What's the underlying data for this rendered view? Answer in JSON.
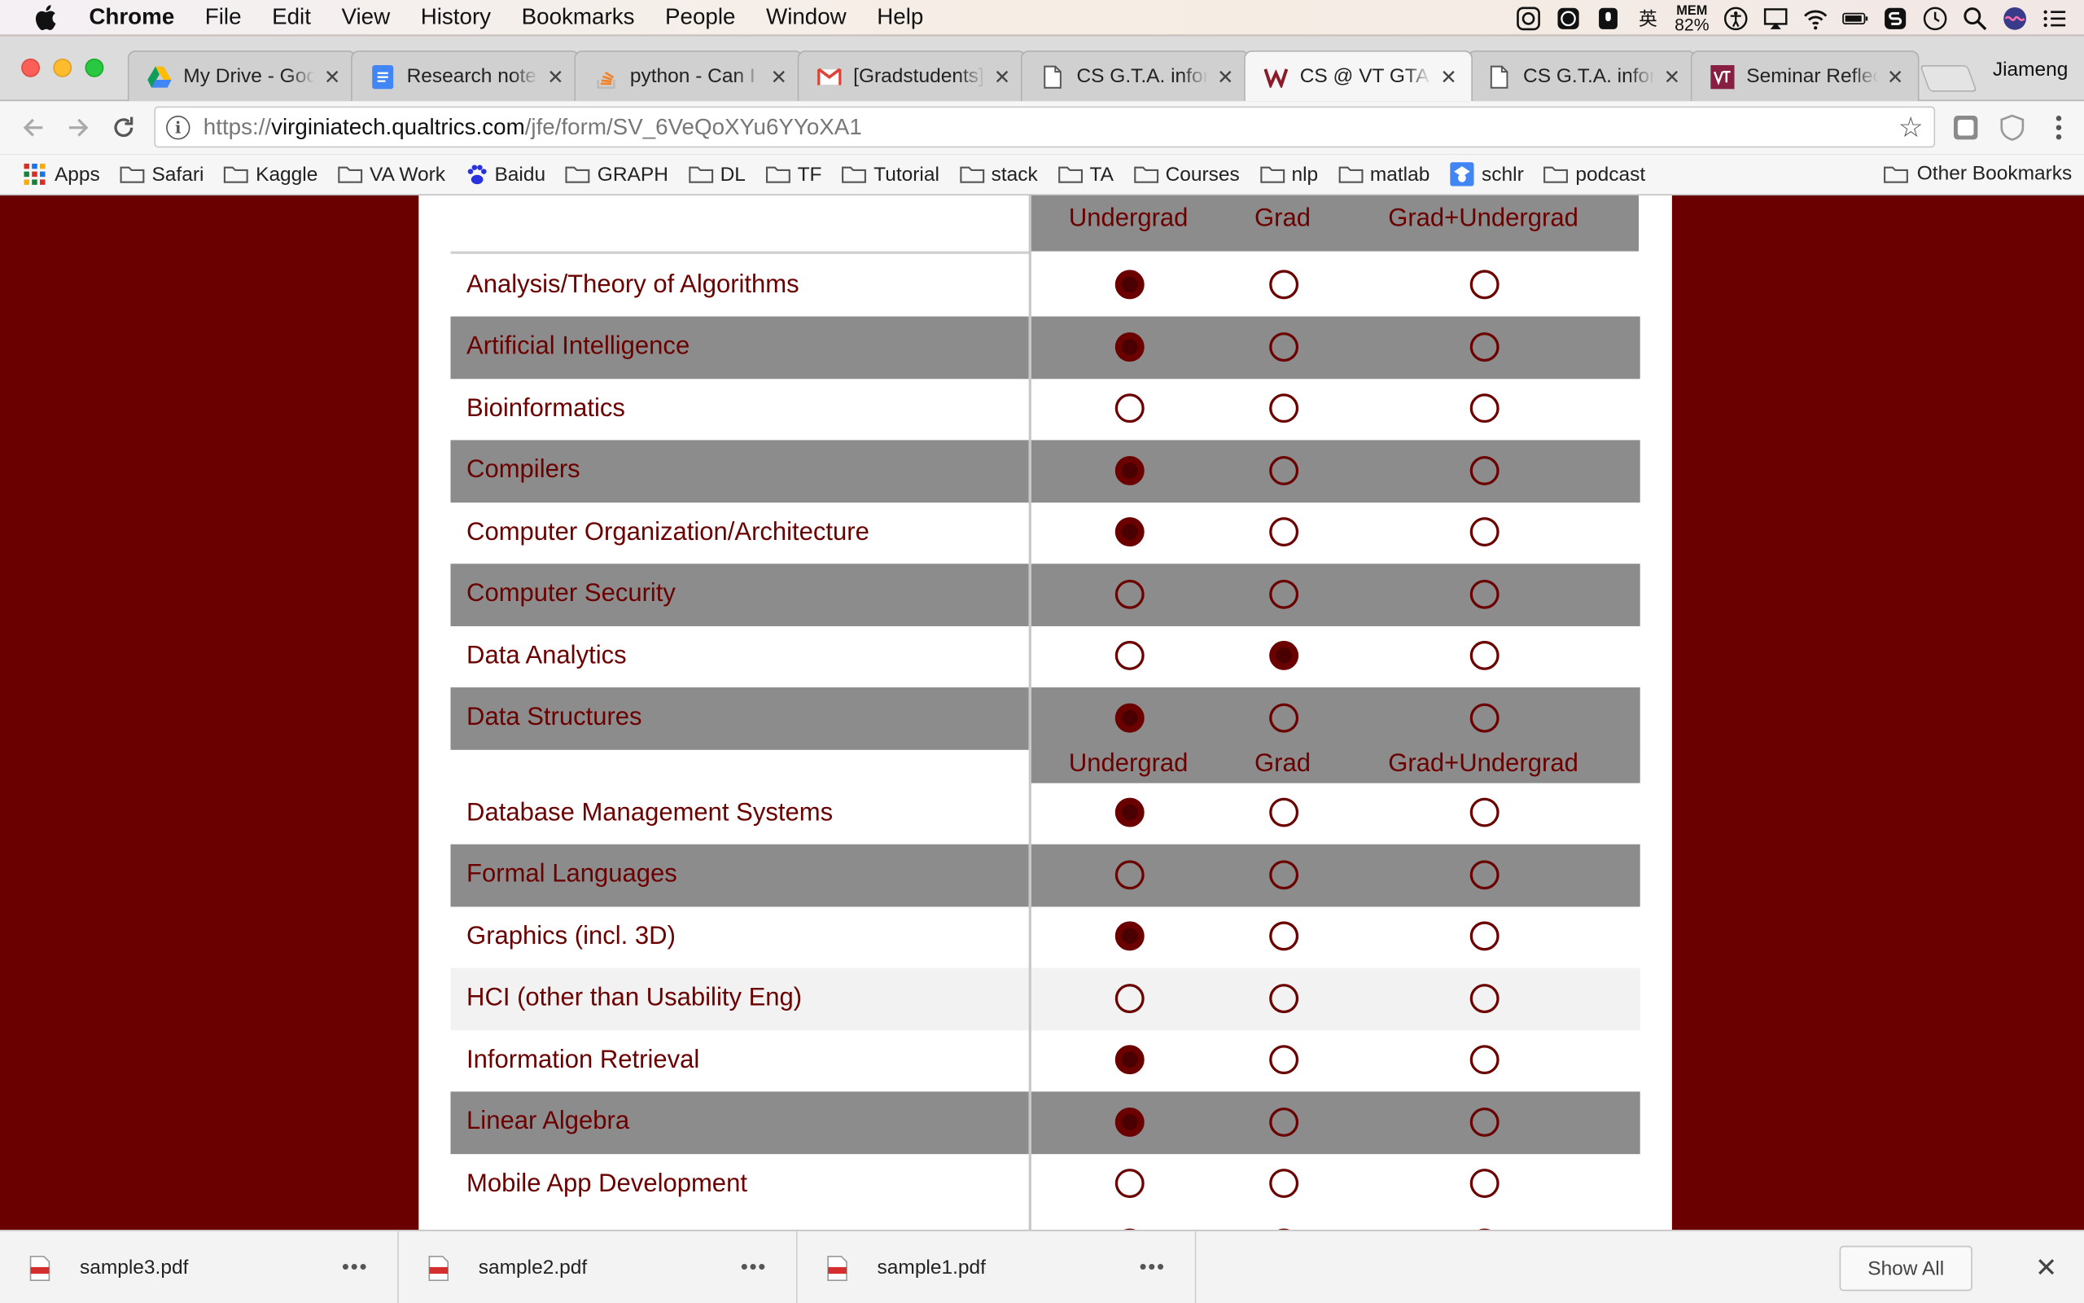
{
  "menubar": {
    "app": "Chrome",
    "items": [
      "File",
      "Edit",
      "View",
      "History",
      "Bookmarks",
      "People",
      "Window",
      "Help"
    ],
    "tray": {
      "mem_label": "MEM",
      "mem_pct": "82%",
      "ime": "英"
    }
  },
  "tabs": [
    {
      "label": "My Drive - Google Drive",
      "icon": "google-drive-icon"
    },
    {
      "label": "Research notes",
      "icon": "google-docs-icon"
    },
    {
      "label": "python - Can I",
      "icon": "stackoverflow-icon"
    },
    {
      "label": "[Gradstudents]",
      "icon": "gmail-icon"
    },
    {
      "label": "CS G.T.A. information",
      "icon": "page-icon"
    },
    {
      "label": "CS @ VT GTA Survey",
      "icon": "qualtrics-icon",
      "active": true
    },
    {
      "label": "CS G.T.A. information",
      "icon": "page-icon"
    },
    {
      "label": "Seminar Reflection",
      "icon": "vt-icon"
    }
  ],
  "profile": "Jiameng",
  "address": {
    "scheme": "https://",
    "host": "virginiatech.qualtrics.com",
    "path": "/jfe/form/SV_6VeQoXYu6YYoXA1"
  },
  "bookmarks": {
    "apps": "Apps",
    "items": [
      "Safari",
      "Kaggle",
      "VA Work",
      "Baidu",
      "GRAPH",
      "DL",
      "TF",
      "Tutorial",
      "stack",
      "TA",
      "Courses",
      "nlp",
      "matlab",
      "schlr",
      "podcast"
    ],
    "other": "Other Bookmarks"
  },
  "matrix": {
    "columns": [
      "Undergrad",
      "Grad",
      "Grad+Undergrad"
    ],
    "rows": [
      {
        "label": "Analysis/Theory of Algorithms",
        "selected": 0
      },
      {
        "label": "Artificial Intelligence",
        "selected": 0
      },
      {
        "label": "Bioinformatics",
        "selected": -1
      },
      {
        "label": "Compilers",
        "selected": 0
      },
      {
        "label": "Computer Organization/Architecture",
        "selected": 0
      },
      {
        "label": "Computer Security",
        "selected": -1
      },
      {
        "label": "Data Analytics",
        "selected": 1
      },
      {
        "label": "Data Structures",
        "selected": 0
      },
      {
        "label": "Database Management Systems",
        "selected": 0
      },
      {
        "label": "Formal Languages",
        "selected": -1
      },
      {
        "label": "Graphics (incl. 3D)",
        "selected": 0
      },
      {
        "label": "HCI (other than Usability Eng)",
        "selected": -1
      },
      {
        "label": "Information Retrieval",
        "selected": 0
      },
      {
        "label": "Linear Algebra",
        "selected": 0
      },
      {
        "label": "Mobile App Development",
        "selected": -1
      }
    ]
  },
  "downloads": {
    "files": [
      "sample3.pdf",
      "sample2.pdf",
      "sample1.pdf"
    ],
    "show_all": "Show All"
  },
  "colors": {
    "accent": "#6b0000",
    "row_alt": "#8c8c8c"
  }
}
